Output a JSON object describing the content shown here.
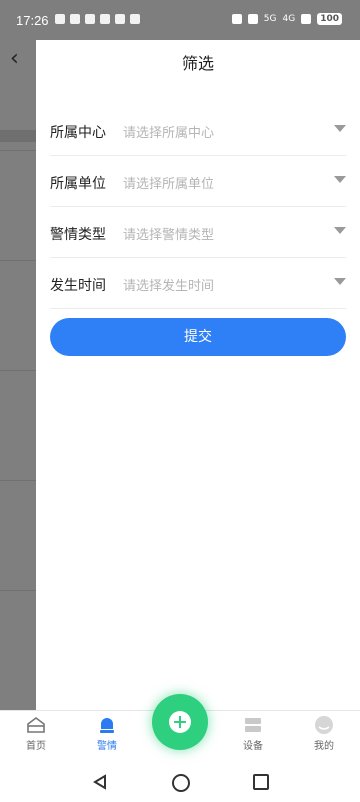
{
  "status_bar": {
    "time": "17:26",
    "battery": "100",
    "network_1": "5G",
    "network_2": "4G"
  },
  "drawer": {
    "title": "筛选",
    "filters": [
      {
        "label": "所属中心",
        "placeholder": "请选择所属中心"
      },
      {
        "label": "所属单位",
        "placeholder": "请选择所属单位"
      },
      {
        "label": "警情类型",
        "placeholder": "请选择警情类型"
      },
      {
        "label": "发生时间",
        "placeholder": "请选择发生时间"
      }
    ],
    "submit_label": "提交"
  },
  "bottom_nav": {
    "items": [
      {
        "label": "首页",
        "icon": "home-icon"
      },
      {
        "label": "警情",
        "icon": "alert-icon"
      },
      {
        "label": "设备",
        "icon": "device-icon"
      },
      {
        "label": "我的",
        "icon": "profile-icon"
      }
    ],
    "fab_icon": "plus-icon",
    "active_color": "#2a7af0"
  },
  "colors": {
    "accent": "#2f80f6",
    "fab": "#2ecf7f"
  }
}
